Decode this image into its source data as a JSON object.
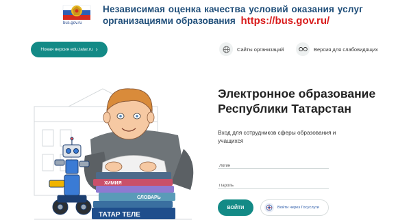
{
  "banner": {
    "logo_text": "bus.gov.ru",
    "line1": "Независимая оценка качества условий оказания услуг",
    "line2": "организациями образования",
    "url": "https://bus.gov.ru/"
  },
  "nav": {
    "new_version_label": "Новая версия edu.tatar.ru",
    "sites_label": "Сайты организаций",
    "impaired_label": "Версия для слабовидящих"
  },
  "illustration": {
    "book_labels": [
      "ХИМИЯ",
      "СЛОВАРЬ",
      "ТАТАР ТЕЛЕ"
    ]
  },
  "main": {
    "title_line1": "Электронное образование",
    "title_line2": "Республики Татарстан",
    "subtitle": "Вход для сотрудников сферы образования и учащихся",
    "login_placeholder": "Логин",
    "password_placeholder": "Пароль",
    "login_button": "ВОЙТИ",
    "gosuslugi_button": "Войти через Госуслуги"
  },
  "colors": {
    "accent": "#138a86",
    "banner_text": "#1f4e79",
    "url_red": "#d91c1c"
  }
}
